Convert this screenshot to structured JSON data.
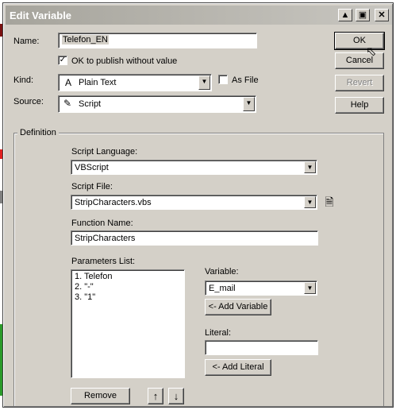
{
  "window": {
    "title": "Edit Variable"
  },
  "name": {
    "label": "Name:",
    "value": "Telefon_EN"
  },
  "publish": {
    "label": "OK to publish without value",
    "checked": true
  },
  "kind": {
    "label": "Kind:",
    "value": "Plain Text",
    "icon": "A"
  },
  "as_file": {
    "label": "As File",
    "checked": false
  },
  "source": {
    "label": "Source:",
    "value": "Script"
  },
  "buttons": {
    "ok": "OK",
    "cancel": "Cancel",
    "revert": "Revert",
    "help": "Help"
  },
  "definition": {
    "title": "Definition",
    "script_language": {
      "label": "Script Language:",
      "value": "VBScript"
    },
    "script_file": {
      "label": "Script File:",
      "value": "StripCharacters.vbs"
    },
    "function_name": {
      "label": "Function Name:",
      "value": "StripCharacters"
    },
    "parameters": {
      "label": "Parameters List:",
      "items": [
        "1. Telefon",
        "2. \"-\"",
        "3. \"1\""
      ]
    },
    "variable": {
      "label": "Variable:",
      "value": "E_mail",
      "add_button": "<- Add Variable"
    },
    "literal": {
      "label": "Literal:",
      "value": "",
      "add_button": "<- Add Literal"
    },
    "remove_button": "Remove",
    "up_icon": "↑",
    "down_icon": "↓"
  }
}
